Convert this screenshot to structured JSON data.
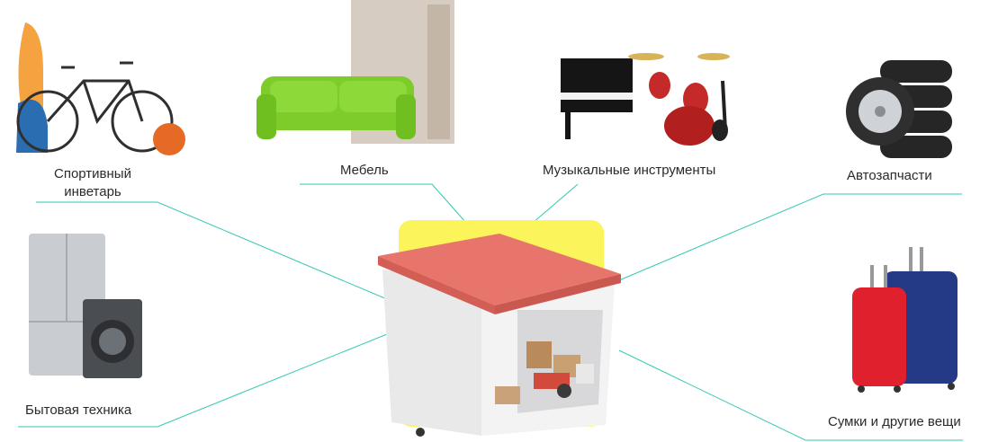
{
  "categories": {
    "sport": "Спортивный\nинветарь",
    "furniture": "Мебель",
    "music": "Музыкальные инструменты",
    "auto": "Автозапчасти",
    "appliances": "Бытовая техника",
    "bags": "Сумки и другие вещи"
  },
  "accent_colors": {
    "connector_line": "#33c9b3",
    "highlight": "#fbf45a",
    "roof": "#e8756c"
  },
  "icons": [
    "sports-equipment-image",
    "sofa-wardrobe-image",
    "piano-drums-guitar-image",
    "tires-stack-image",
    "fridge-washer-image",
    "suitcases-image",
    "storage-box-image"
  ]
}
